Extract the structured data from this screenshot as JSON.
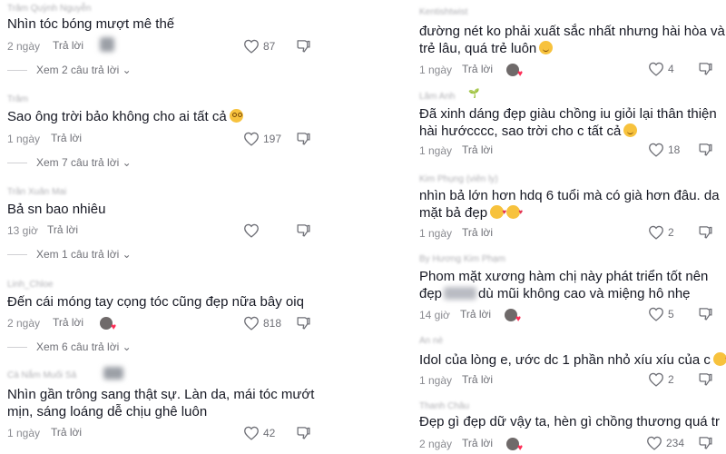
{
  "left": {
    "comments": [
      {
        "user": "Trâm Quỳnh Nguyễn",
        "text": "Nhìn tóc bóng mượt mê thế",
        "time": "2 ngày",
        "reply": "Trả lời",
        "likes": "87",
        "view_replies": "Xem 2 câu trả lời"
      },
      {
        "user": "Trâm",
        "text": "Sao ông trời bảo không cho ai tất cả",
        "time": "1 ngày",
        "reply": "Trả lời",
        "likes": "197",
        "view_replies": "Xem 7 câu trả lời"
      },
      {
        "user": "Trần Xuân Mai",
        "text": "Bả sn bao nhiêu",
        "time": "13 giờ",
        "reply": "Trả lời",
        "likes": "",
        "view_replies": "Xem 1 câu trả lời"
      },
      {
        "user": "Linh_Chloe",
        "text": "Đến cái móng tay cọng tóc cũng đẹp nữa bây oiq",
        "time": "2 ngày",
        "reply": "Trả lời",
        "likes": "818",
        "view_replies": "Xem 6 câu trả lời"
      },
      {
        "user": "Cà Nắm Muối Sả",
        "text_line1": "Nhìn gần trông sang thật sự. Làn da, mái tóc mướt",
        "text_line2": "mịn, sáng loáng dễ chịu ghê luôn",
        "time": "1 ngày",
        "reply": "Trả lời",
        "likes": "42"
      }
    ]
  },
  "right": {
    "comments": [
      {
        "user": "Kentishtwist",
        "text_line1": "đường nét ko phải xuất sắc nhất nhưng hài hòa và",
        "text_line2": "trẻ lâu, quá trẻ luôn",
        "time": "1 ngày",
        "reply": "Trả lời",
        "likes": "4"
      },
      {
        "user": "Lâm Anh",
        "text_line1": "Đã xinh dáng đẹp giàu chồng iu giỏi lại thân thiện",
        "text_line2": "hài hướcccc, sao trời cho c tất cả",
        "time": "1 ngày",
        "reply": "Trả lời",
        "likes": "18"
      },
      {
        "user": "Kim Phụng (viên ly)",
        "text_line1": "nhìn bả lớn hơn hdq 6 tuổi mà có già hơn đâu. da",
        "text_line2": "mặt bả đẹp",
        "time": "1 ngày",
        "reply": "Trả lời",
        "likes": "2"
      },
      {
        "user": "By Hương Kim Phạm",
        "text_line1": "Phom mặt xương hàm chị này phát triển tốt nên",
        "text_line2a": "đẹp",
        "text_line2b": "dù mũi không cao và miệng hô nhẹ",
        "time": "14 giờ",
        "reply": "Trả lời",
        "likes": "5"
      },
      {
        "user": "An nè",
        "text": "Idol của lòng e, ước dc 1 phần nhỏ xíu xíu của c",
        "time": "1 ngày",
        "reply": "Trả lời",
        "likes": "2"
      },
      {
        "user": "Thanh Châu",
        "text": "Đẹp gì đẹp dữ vậy ta, hèn gì chồng thương quá tr",
        "time": "2 ngày",
        "reply": "Trả lời",
        "likes": "234"
      }
    ]
  },
  "icons": {
    "like": "heart-outline-icon",
    "dislike": "thumbs-down-icon",
    "expand": "chevron-down-icon"
  },
  "colors": {
    "text": "#161823",
    "meta": "#8a8b91",
    "accent": "#fe2c55"
  }
}
